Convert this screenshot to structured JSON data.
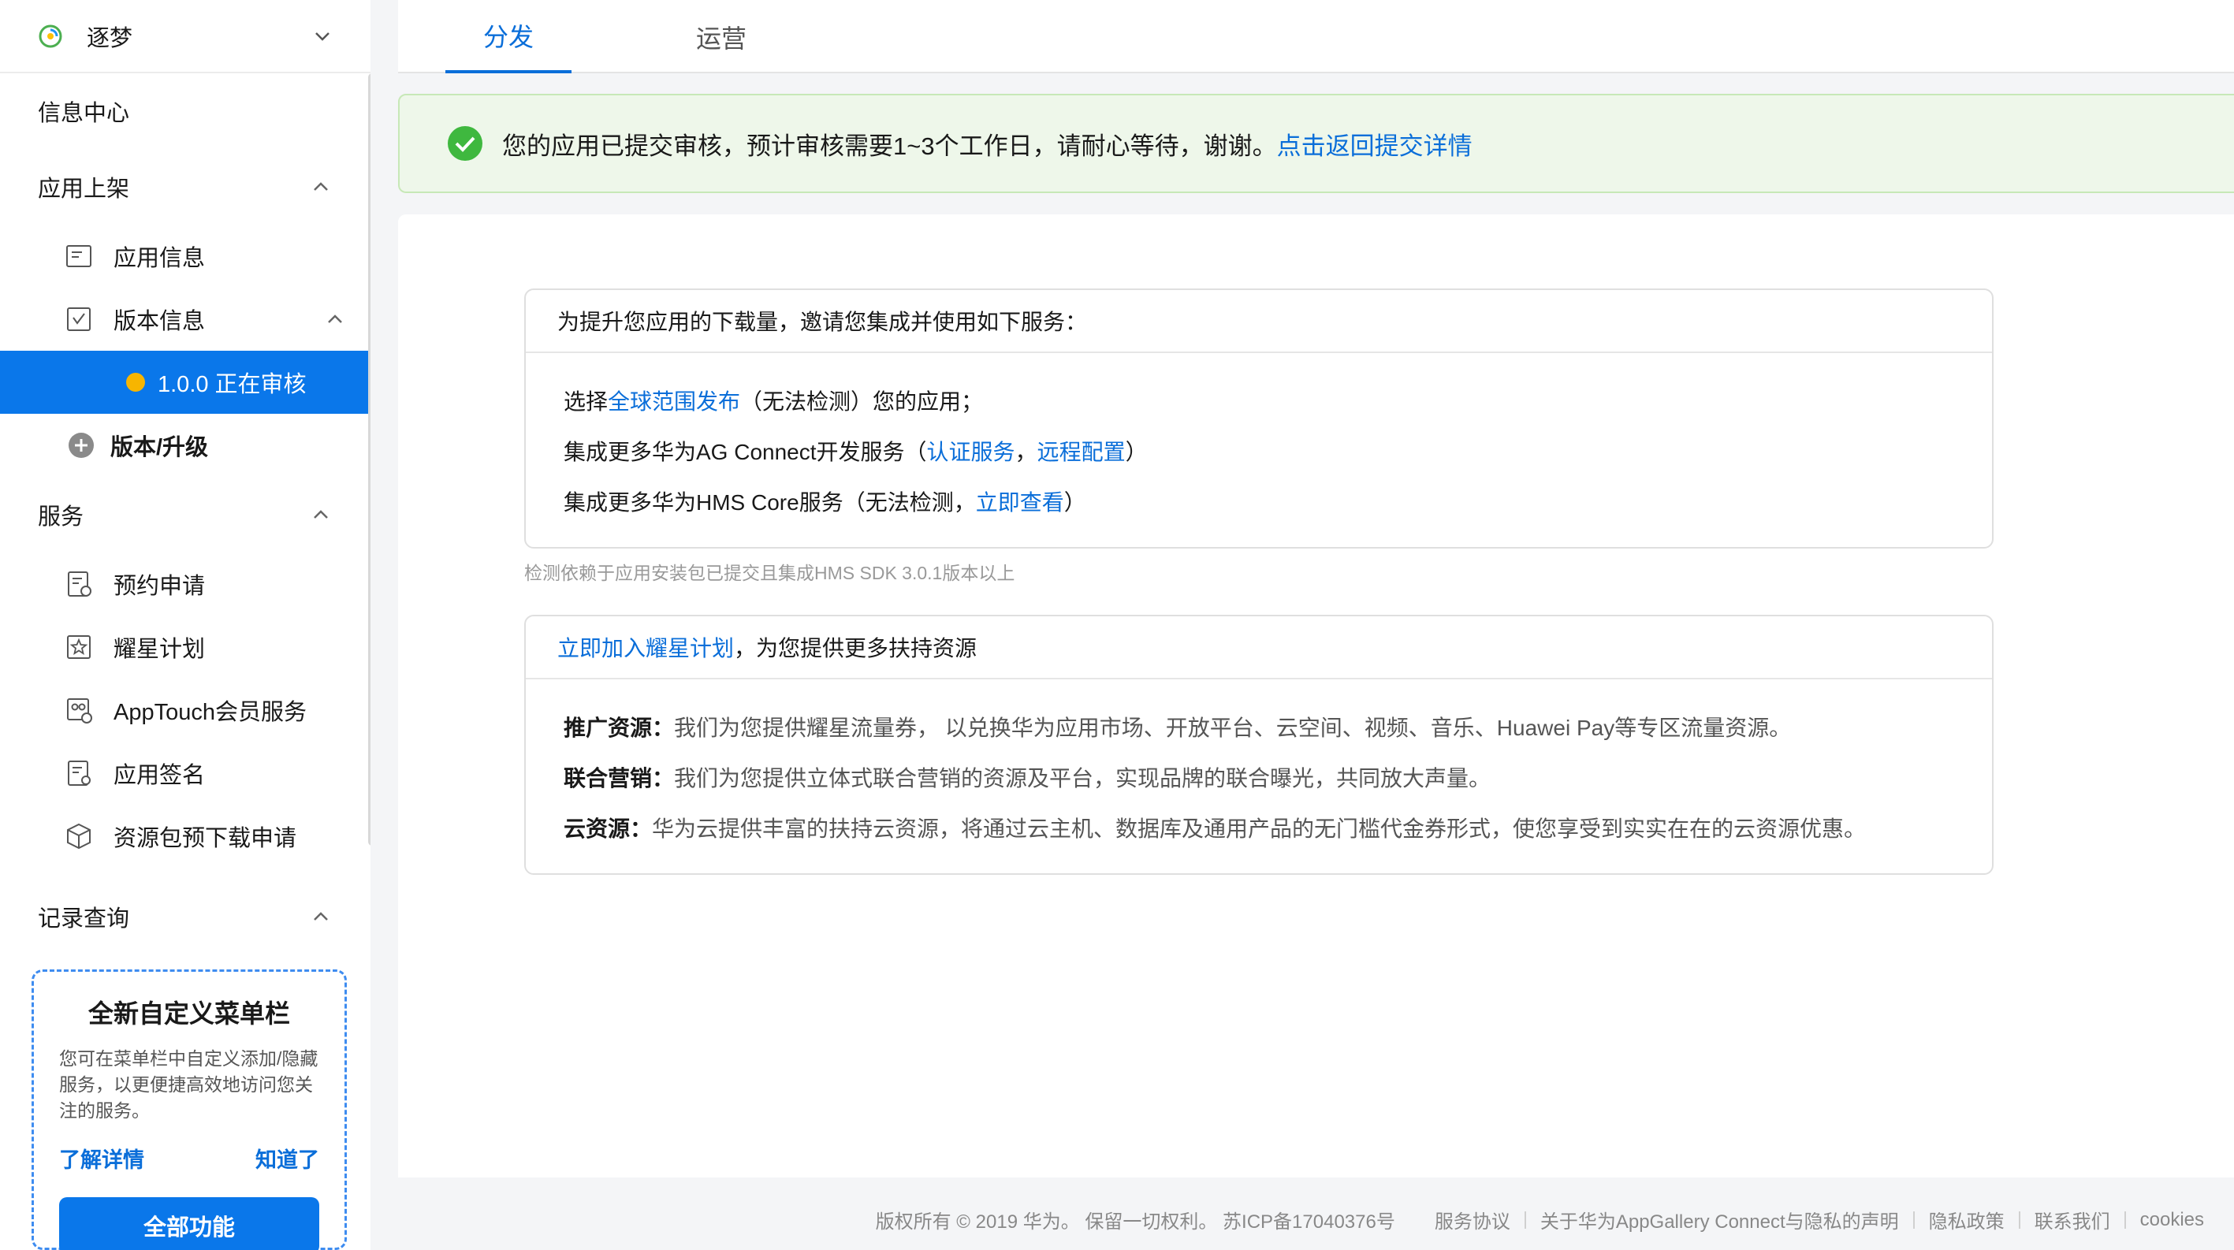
{
  "app": {
    "name": "逐梦"
  },
  "sidebar": {
    "info_center": "信息中心",
    "app_listing": {
      "label": "应用上架",
      "items": {
        "app_info": "应用信息",
        "version_info": "版本信息",
        "active_version": "1.0.0 正在审核",
        "add_version": "版本/升级"
      }
    },
    "services": {
      "label": "服务",
      "items": [
        "预约申请",
        "耀星计划",
        "AppTouch会员服务",
        "应用签名",
        "资源包预下载申请"
      ]
    },
    "records": {
      "label": "记录查询"
    },
    "promo": {
      "title": "全新自定义菜单栏",
      "desc": "您可在菜单栏中自定义添加/隐藏服务，以更便捷高效地访问您关注的服务。",
      "learn_more": "了解详情",
      "got_it": "知道了",
      "all_features": "全部功能"
    }
  },
  "tabs": [
    "分发",
    "运营"
  ],
  "notice": {
    "text": "您的应用已提交审核，预计审核需要1~3个工作日，请耐心等待，谢谢。",
    "link": "点击返回提交详情"
  },
  "card1": {
    "title": "为提升您应用的下载量，邀请您集成并使用如下服务：",
    "line1": {
      "a": "选择",
      "link": "全球范围发布",
      "b": "（无法检测）您的应用；"
    },
    "line2": {
      "a": "集成更多华为AG Connect开发服务（",
      "link1": "认证服务",
      "sep": "，",
      "link2": "远程配置",
      "b": "）"
    },
    "line3": {
      "a": "集成更多华为HMS Core服务（无法检测，",
      "link": "立即查看",
      "b": "）"
    }
  },
  "note": "检测依赖于应用安装包已提交且集成HMS SDK 3.0.1版本以上",
  "card2": {
    "title_link": "立即加入耀星计划",
    "title_rest": "，为您提供更多扶持资源",
    "rows": [
      {
        "label": "推广资源：",
        "text": "我们为您提供耀星流量券， 以兑换华为应用市场、开放平台、云空间、视频、音乐、Huawei Pay等专区流量资源。"
      },
      {
        "label": "联合营销：",
        "text": "我们为您提供立体式联合营销的资源及平台，实现品牌的联合曝光，共同放大声量。"
      },
      {
        "label": "云资源：",
        "text": "华为云提供丰富的扶持云资源，将通过云主机、数据库及通用产品的无门槛代金券形式，使您享受到实实在在的云资源优惠。"
      }
    ]
  },
  "footer": {
    "copyright": "版权所有 © 2019 华为。 保留一切权利。 苏ICP备17040376号",
    "links": [
      "服务协议",
      "关于华为AppGallery Connect与隐私的声明",
      "隐私政策",
      "联系我们",
      "cookies"
    ]
  },
  "colors": {
    "accent": "#0a77ea",
    "link": "#0a6ed9",
    "success": "#3fb83f",
    "pending": "#f7b500"
  }
}
